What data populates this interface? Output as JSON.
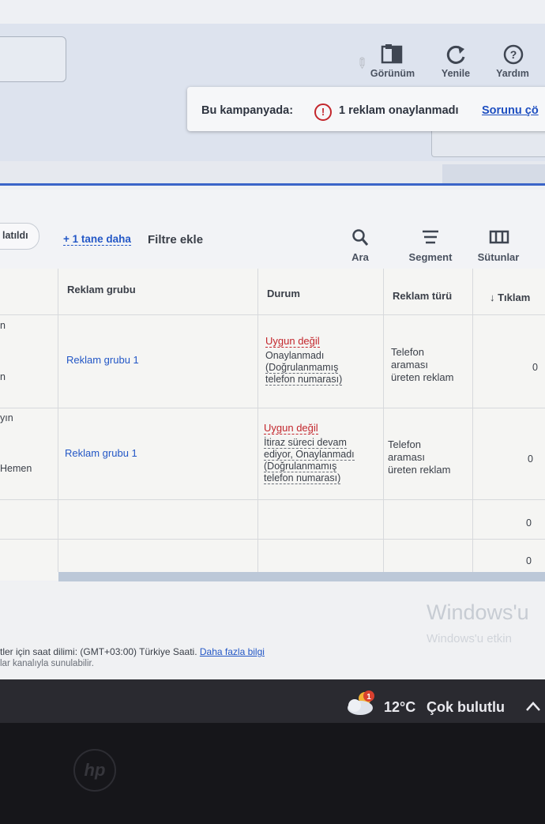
{
  "toolbar": {
    "view_label": "Görünüm",
    "refresh_label": "Yenile",
    "help_label": "Yardım"
  },
  "banner": {
    "prefix": "Bu kampanyada:",
    "message": "1 reklam onaylanmadı",
    "link": "Sorunu çö"
  },
  "filters": {
    "chip_label": "latıldı",
    "more_link": "+ 1 tane daha",
    "add_filter": "Filtre ekle"
  },
  "actions": {
    "search": "Ara",
    "segment": "Segment",
    "columns": "Sütunlar"
  },
  "table": {
    "headers": {
      "ad_group": "Reklam grubu",
      "status": "Durum",
      "ad_type": "Reklam türü",
      "clicks": "↓ Tıklam"
    },
    "rows": [
      {
        "left_fragments": [
          "n",
          "n"
        ],
        "ad_group": "Reklam grubu 1",
        "status_title": "Uygun değil",
        "status_lines": [
          "Onaylanmadı",
          "(Doğrulanmamış",
          "telefon numarası)"
        ],
        "ad_type_lines": [
          "Telefon",
          "araması",
          "üreten reklam"
        ],
        "clicks": "0"
      },
      {
        "left_fragments": [
          "yın",
          "Hemen"
        ],
        "ad_group": "Reklam grubu 1",
        "status_title": "Uygun değil",
        "status_lines": [
          "İtiraz süreci devam",
          "ediyor, Onaylanmadı",
          "(Doğrulanmamış",
          "telefon numarası)"
        ],
        "ad_type_lines": [
          "Telefon",
          "araması",
          "üreten reklam"
        ],
        "clicks": "0"
      }
    ],
    "total_rows": [
      "0",
      "0"
    ]
  },
  "footer": {
    "timezone_text": "tler için saat dilimi: (GMT+03:00) Türkiye Saati.",
    "timezone_link": "Daha fazla bilgi",
    "channel_text": "lar kanalıyla sunulabilir."
  },
  "watermark": {
    "line1": "Windows'u",
    "line2": "Windows'u etkin"
  },
  "taskbar": {
    "temperature": "12°C",
    "weather": "Çok bulutlu",
    "badge": "1"
  },
  "colors": {
    "link_blue": "#2357c6",
    "error_red": "#c3262c",
    "accent_blue": "#3a64c8"
  }
}
